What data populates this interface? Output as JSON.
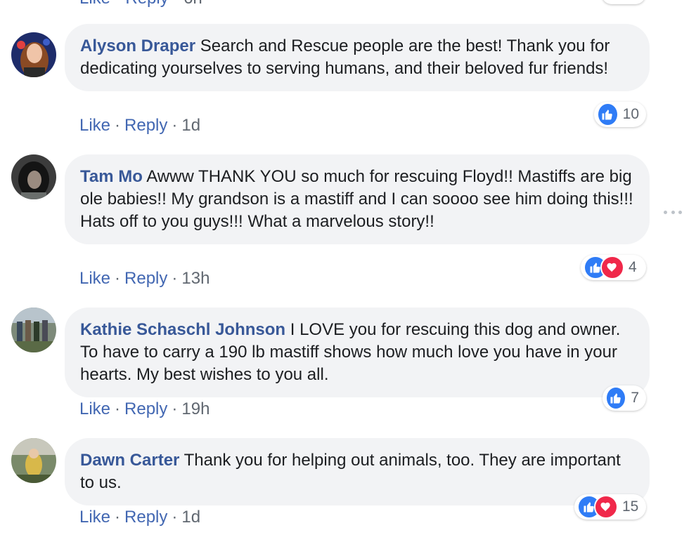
{
  "previous": {
    "like_label": "Like",
    "reply_label": "Reply",
    "time": "6h"
  },
  "comments": [
    {
      "author": "Alyson Draper",
      "text": "Search and Rescue people are the best! Thank you for dedicating yourselves to serving humans, and their beloved fur friends!",
      "like_label": "Like",
      "reply_label": "Reply",
      "time": "1d",
      "reactions": [
        "like"
      ],
      "reaction_count": "10"
    },
    {
      "author": "Tam Mo",
      "text": "Awww THANK YOU so much for rescuing Floyd!! Mastiffs are big ole babies!! My grandson is a mastiff and I can soooo see him doing this!!! Hats off to you guys!!! What a marvelous story!!",
      "like_label": "Like",
      "reply_label": "Reply",
      "time": "13h",
      "reactions": [
        "like",
        "love"
      ],
      "reaction_count": "4"
    },
    {
      "author": "Kathie Schaschl Johnson",
      "text": "I LOVE you for rescuing this dog and owner. To have to carry a 190 lb mastiff shows how much love you have in your hearts. My best wishes to you all.",
      "like_label": "Like",
      "reply_label": "Reply",
      "time": "19h",
      "reactions": [
        "like"
      ],
      "reaction_count": "7"
    },
    {
      "author": "Dawn Carter",
      "text": "Thank you for helping out animals, too. They are important to us.",
      "like_label": "Like",
      "reply_label": "Reply",
      "time": "1d",
      "reactions": [
        "like",
        "love"
      ],
      "reaction_count": "15"
    }
  ],
  "colors": {
    "author": "#385898",
    "link": "#4267b2",
    "meta": "#606770",
    "bubble": "#f2f3f5",
    "like": "#2f7cf6",
    "love": "#f0284a"
  },
  "icons": {
    "like": "thumbs-up-icon",
    "love": "heart-icon",
    "more": "more-options-icon"
  }
}
